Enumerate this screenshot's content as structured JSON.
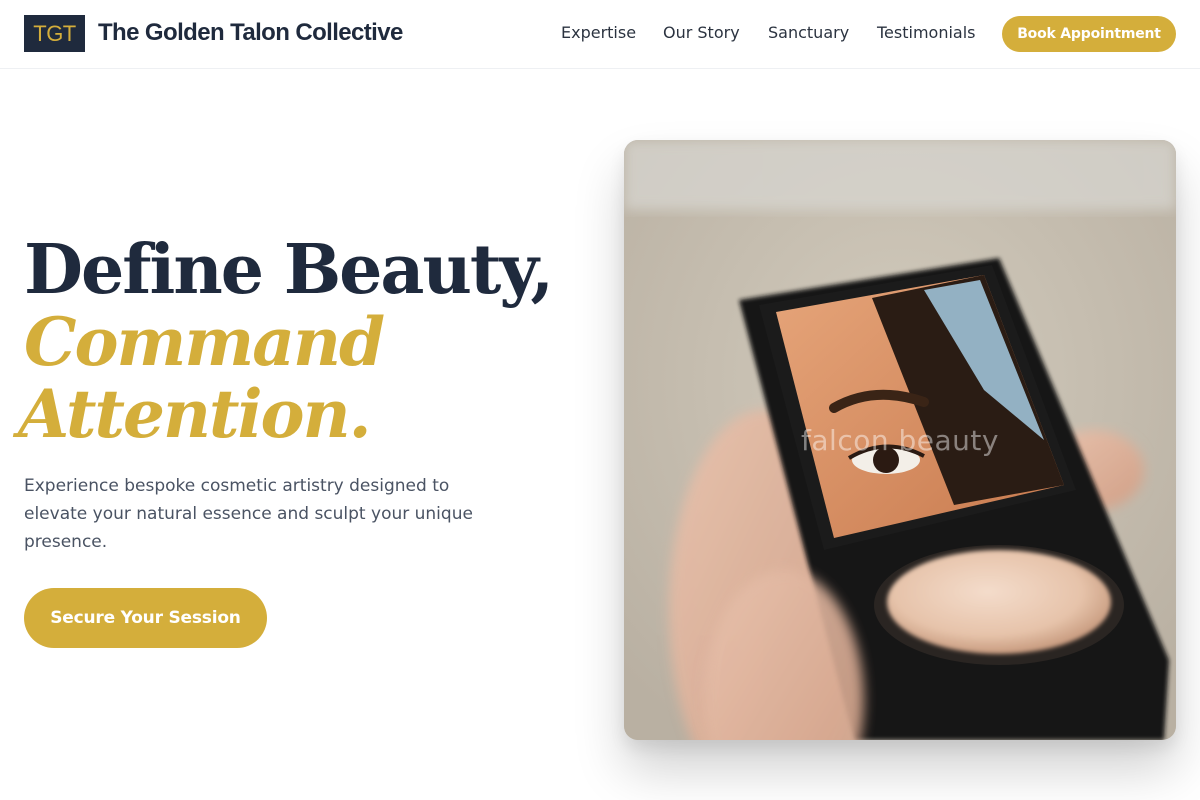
{
  "header": {
    "logo_mark": "TGT",
    "brand_name": "The Golden Talon Collective",
    "nav": [
      {
        "label": "Expertise"
      },
      {
        "label": "Our Story"
      },
      {
        "label": "Sanctuary"
      },
      {
        "label": "Testimonials"
      }
    ],
    "cta_label": "Book Appointment"
  },
  "hero": {
    "headline_line1": "Define Beauty,",
    "headline_line2": "Command",
    "headline_line3": "Attention.",
    "subtext": "Experience bespoke cosmetic artistry designed to elevate your natural essence and sculpt your unique presence.",
    "cta_label": "Secure Your Session",
    "image": {
      "watermark": "falcon beauty"
    }
  },
  "colors": {
    "accent": "#d4ae3b",
    "navy": "#1f2a3d",
    "body_text": "#4a5363"
  }
}
